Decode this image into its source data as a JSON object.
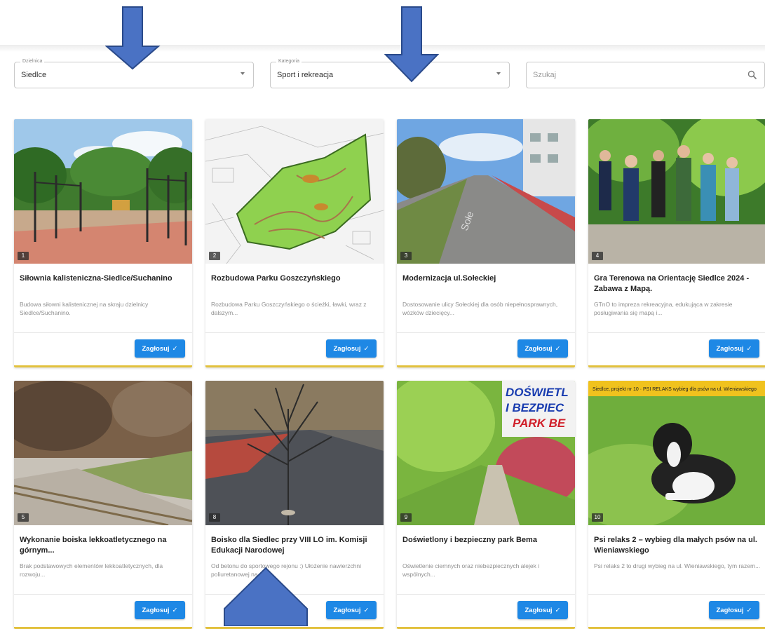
{
  "filters": {
    "district": {
      "label": "Dzielnica",
      "value": "Siedlce"
    },
    "category": {
      "label": "Kategoria",
      "value": "Sport i rekreacja"
    },
    "search": {
      "placeholder": "Szukaj"
    }
  },
  "vote_label": "Zagłosuj",
  "vote_check": "✓",
  "projects": [
    {
      "number": "1",
      "title": "Siłownia kalisteniczna-Siedlce/Suchanino",
      "description": "Budowa siłowni kalistenicznej na skraju dzielnicy Siedlce/Suchanino."
    },
    {
      "number": "2",
      "title": "Rozbudowa Parku Goszczyńskiego",
      "description": "Rozbudowa Parku Goszczyńskiego o ścieżki, ławki, wraz z dalszym..."
    },
    {
      "number": "3",
      "title": "Modernizacja ul.Sołeckiej",
      "description": "Dostosowanie ulicy Sołeckiej dla osób niepełnosprawnych, wózków dziecięcy..."
    },
    {
      "number": "4",
      "title": "Gra Terenowa na Orientację Siedlce 2024 - Zabawa z Mapą.",
      "description": "GTnO to impreza rekreacyjna, edukująca w zakresie posługiwania się mapą i..."
    },
    {
      "number": "5",
      "title": "Wykonanie boiska lekkoatletycznego na górnym...",
      "description": "Brak podstawowych elementów lekkoatletycznych, dla rozwoju..."
    },
    {
      "number": "8",
      "title": "Boisko dla Siedlec przy VIII LO im. Komisji Edukacji Narodowej",
      "description": "Od betonu do sportowego rejonu :) Ułożenie nawierzchni poliuretanowej na..."
    },
    {
      "number": "9",
      "title": "Doświetlony i bezpieczny park Bema",
      "description": "Oświetlenie ciemnych oraz niebezpiecznych alejek i wspólnych..."
    },
    {
      "number": "10",
      "title": "Psi relaks 2 – wybieg dla małych psów na ul. Wieniawskiego",
      "description": "Psi relaks 2 to drugi wybieg na ul. Wieniawskiego, tym razem..."
    }
  ],
  "image_text": {
    "poster_line1": "DOŚWIETL",
    "poster_line2": "I BEZPIEC",
    "poster_line3": "PARK BE",
    "dog_banner": "Siedlce, projekt nr 10 · PSI RELAKS wybieg dla psów na ul. Wieniawskiego"
  },
  "colors": {
    "accent": "#1e88e5",
    "card_stripe": "#e2c13d",
    "annotation_arrow": "#4a72c4"
  }
}
